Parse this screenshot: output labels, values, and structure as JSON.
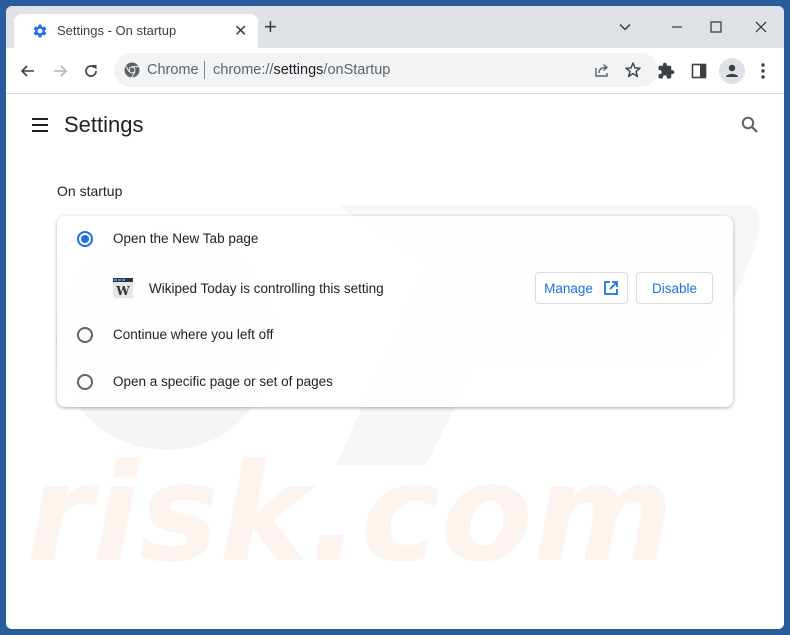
{
  "browser": {
    "tab": {
      "title": "Settings - On startup",
      "icon": "gear-icon"
    },
    "omnibox": {
      "origin_label": "Chrome",
      "url_prefix": "chrome://",
      "url_host": "settings",
      "url_path": "/onStartup"
    }
  },
  "settings": {
    "title": "Settings",
    "section": {
      "title": "On startup",
      "options": [
        {
          "label": "Open the New Tab page",
          "selected": true
        },
        {
          "label": "Continue where you left off",
          "selected": false
        },
        {
          "label": "Open a specific page or set of pages",
          "selected": false
        }
      ],
      "extension_notice": {
        "text": "Wikiped Today is controlling this setting",
        "manage_label": "Manage",
        "disable_label": "Disable"
      }
    }
  },
  "watermark": {
    "text": "risk.com"
  },
  "colors": {
    "accent": "#1a73e8",
    "titlebar": "#dee1e6",
    "desktop": "#2a5b9c"
  }
}
